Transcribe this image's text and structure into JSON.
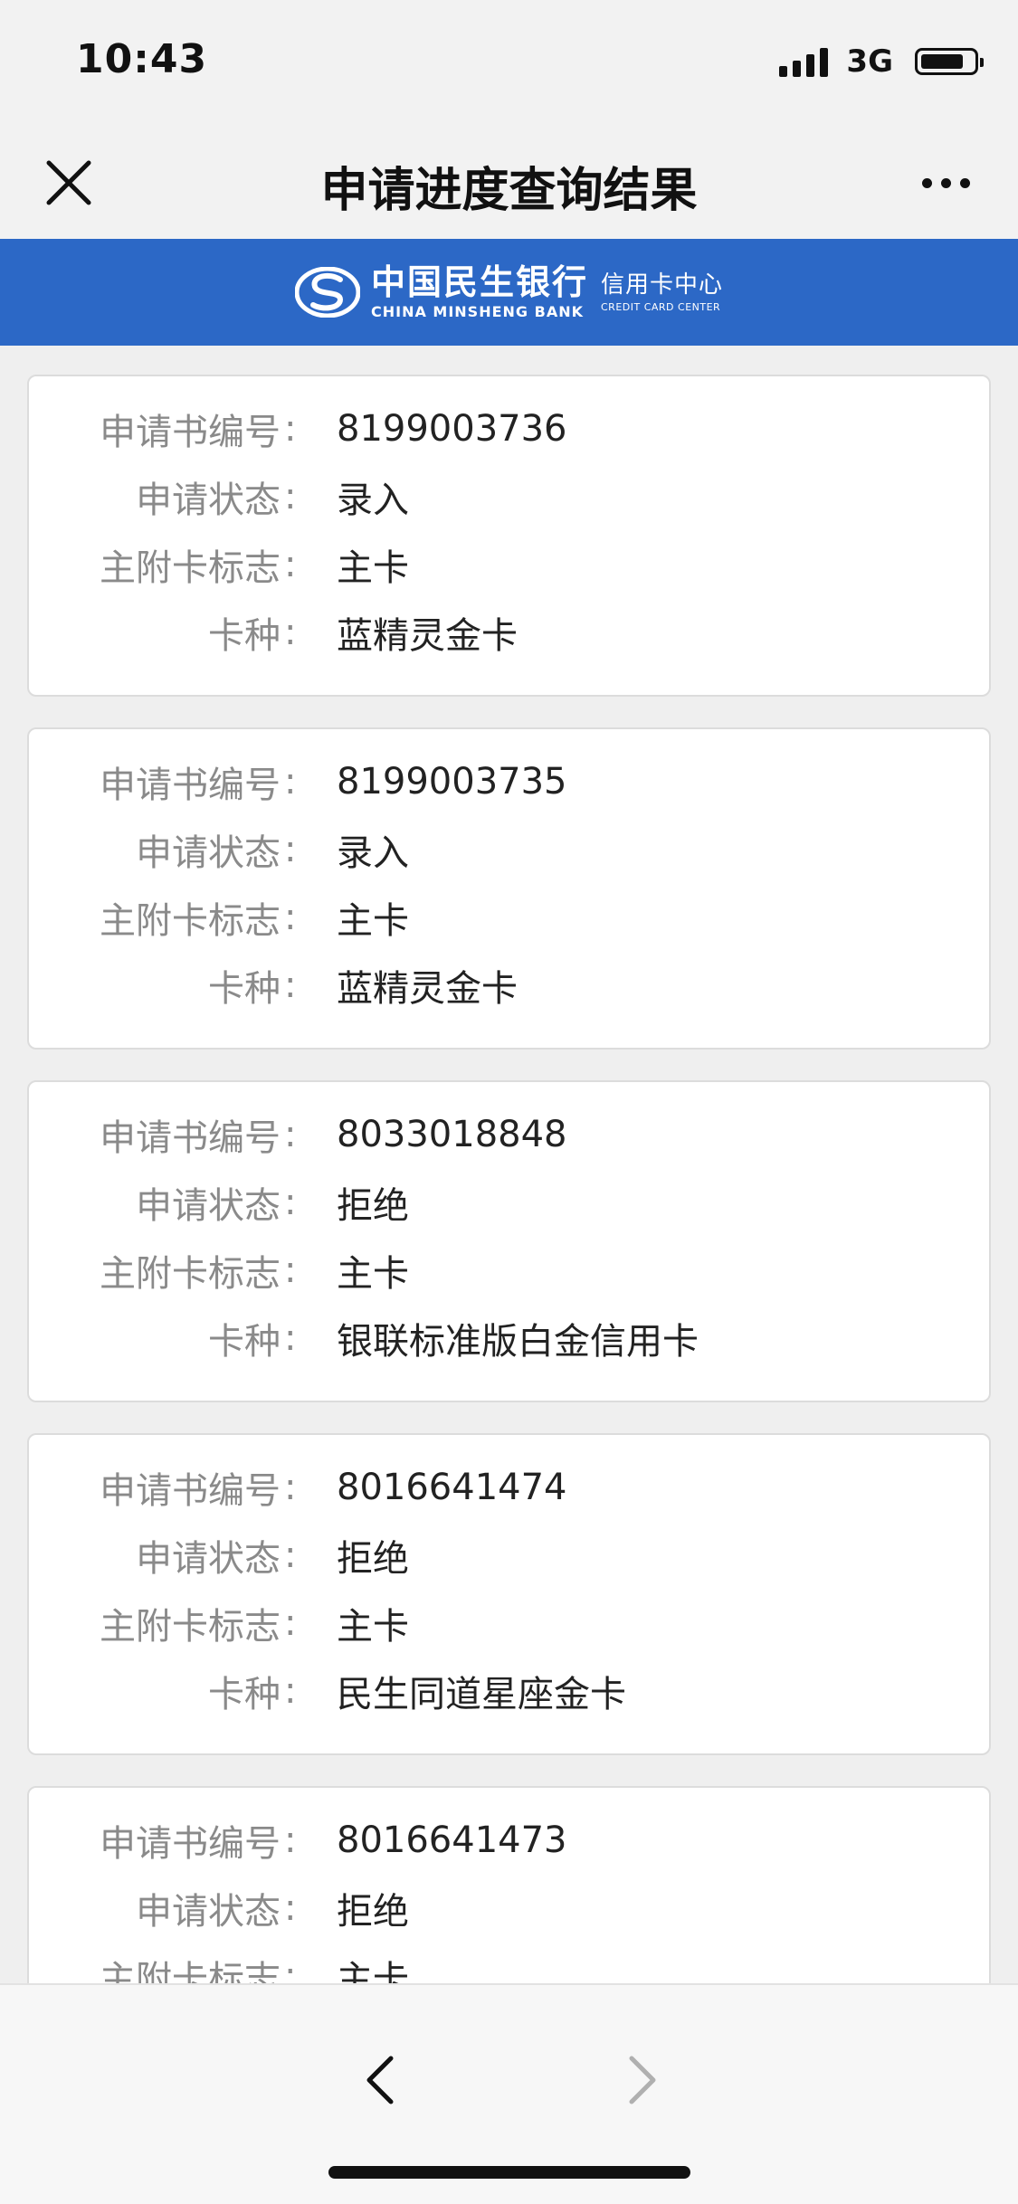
{
  "status_bar": {
    "time": "10:43",
    "network": "3G"
  },
  "nav": {
    "title": "申请进度查询结果",
    "close_icon": "close-icon",
    "more_icon": "more-icon"
  },
  "banner": {
    "bank_name_cn": "中国民生银行",
    "bank_name_en": "CHINA MINSHENG BANK",
    "center_cn": "信用卡中心",
    "center_en": "CREDIT CARD CENTER",
    "brand_color": "#2c68c6"
  },
  "labels": {
    "application_no": "申请书编号",
    "status": "申请状态",
    "card_flag": "主附卡标志",
    "card_type": "卡种",
    "colon": ":"
  },
  "applications": [
    {
      "application_no": "8199003736",
      "status": "录入",
      "card_flag": "主卡",
      "card_type": "蓝精灵金卡"
    },
    {
      "application_no": "8199003735",
      "status": "录入",
      "card_flag": "主卡",
      "card_type": "蓝精灵金卡"
    },
    {
      "application_no": "8033018848",
      "status": "拒绝",
      "card_flag": "主卡",
      "card_type": "银联标准版白金信用卡"
    },
    {
      "application_no": "8016641474",
      "status": "拒绝",
      "card_flag": "主卡",
      "card_type": "民生同道星座金卡"
    },
    {
      "application_no": "8016641473",
      "status": "拒绝",
      "card_flag": "主卡",
      "card_type": ""
    }
  ],
  "toolbar": {
    "back_icon": "chevron-left-icon",
    "forward_icon": "chevron-right-icon"
  }
}
